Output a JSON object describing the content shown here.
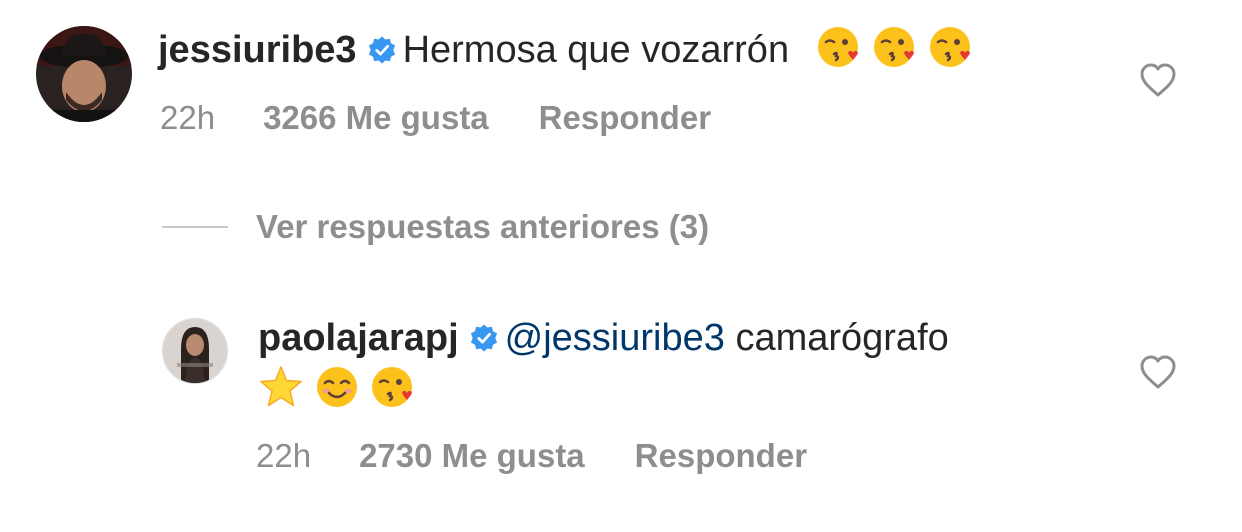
{
  "comments": [
    {
      "username": "jessiuribe3",
      "verified": true,
      "text": "Hermosa que vozarrón",
      "emojis": [
        "face-blowing-kiss",
        "face-blowing-kiss",
        "face-blowing-kiss"
      ],
      "time": "22h",
      "likes": "3266 Me gusta",
      "reply_label": "Responder"
    },
    {
      "username": "paolajarapj",
      "verified": true,
      "mention": "@jessiuribe3",
      "text": "camarógrafo",
      "emojis": [
        "star",
        "smiling-face",
        "face-blowing-kiss"
      ],
      "time": "22h",
      "likes": "2730 Me gusta",
      "reply_label": "Responder"
    }
  ],
  "view_replies": {
    "label": "Ver respuestas anteriores (3)"
  },
  "colors": {
    "text": "#262626",
    "muted": "#8e8e8e",
    "verified": "#3897f0",
    "mention": "#00376b"
  },
  "icons": {
    "verified": "verified-badge-icon",
    "like": "heart-outline-icon"
  }
}
